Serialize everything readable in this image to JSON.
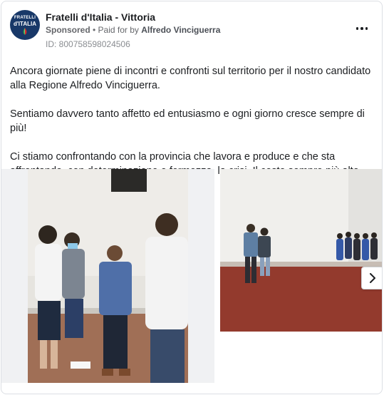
{
  "ad": {
    "page_name": "Fratelli d'Italia - Vittoria",
    "sponsored_label": "Sponsored",
    "paid_for_prefix": " • Paid for by ",
    "funder": "Alfredo Vinciguerra",
    "ad_id": "ID: 800758598024506",
    "avatar": {
      "line1": "FRATELLI",
      "line2": "d'ITALIA"
    },
    "more_icon": "more-horizontal-icon"
  },
  "body": {
    "paragraphs": [
      "Ancora giornate piene di incontri e confronti sul territorio per il nostro candidato alla Regione Alfredo Vinciguerra.",
      "Sentiamo davvero tanto affetto ed entusiasmo e ogni giorno cresce sempre di più!",
      "Ci stiamo confrontando con la provincia che lavora e produce e che sta affrontando, con determinazione e fermezza, la crisi. Il costo sempre più alto…"
    ]
  },
  "carousel": {
    "next_icon": "chevron-right-icon"
  },
  "colors": {
    "brand_navy": "#183868",
    "text_primary": "#1c1e21",
    "text_secondary": "#65676b"
  }
}
